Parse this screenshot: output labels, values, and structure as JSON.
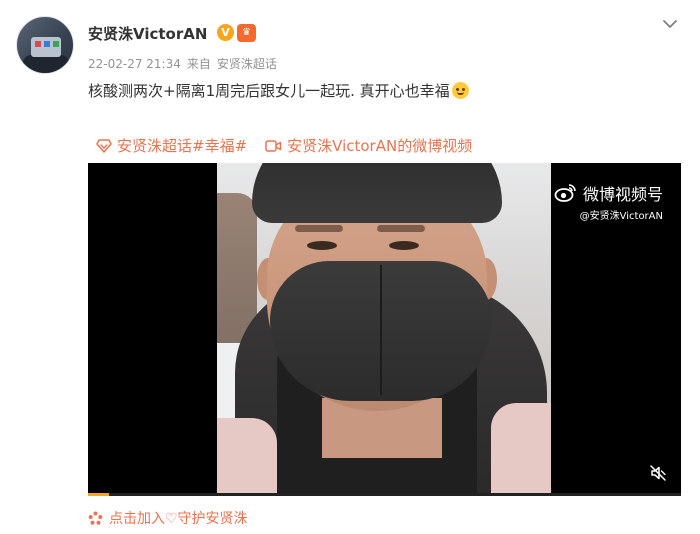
{
  "post": {
    "author": "安贤洙VictorAN",
    "verified_badge": "V",
    "level_badge": "♛",
    "timestamp": "22-02-27 21:34",
    "source_prefix": "来自",
    "source": "安贤洙超话",
    "text": "核酸测两次+隔离1周完后跟女儿一起玩. 真开心也幸福",
    "emoji": "smiling-face-with-hearts"
  },
  "tags": {
    "supertopic": "安贤洙超话#幸福#",
    "video_link": "安贤洙VictorAN的微博视频"
  },
  "video": {
    "watermark_title": "微博视频号",
    "watermark_handle": "@安贤洙VictorAN",
    "progress": 0.035
  },
  "footer": {
    "label": "点击加入♡守护安贤洙"
  },
  "colors": {
    "accent": "#eb7350",
    "meta": "#939393",
    "progress": "#f5a623"
  },
  "icons": {
    "more": "chevron-down-icon",
    "tag": "supertopic-diamond-icon",
    "video": "video-camera-icon",
    "weibo": "weibo-eye-icon",
    "mute": "mute-icon",
    "footer": "flower-icon"
  }
}
